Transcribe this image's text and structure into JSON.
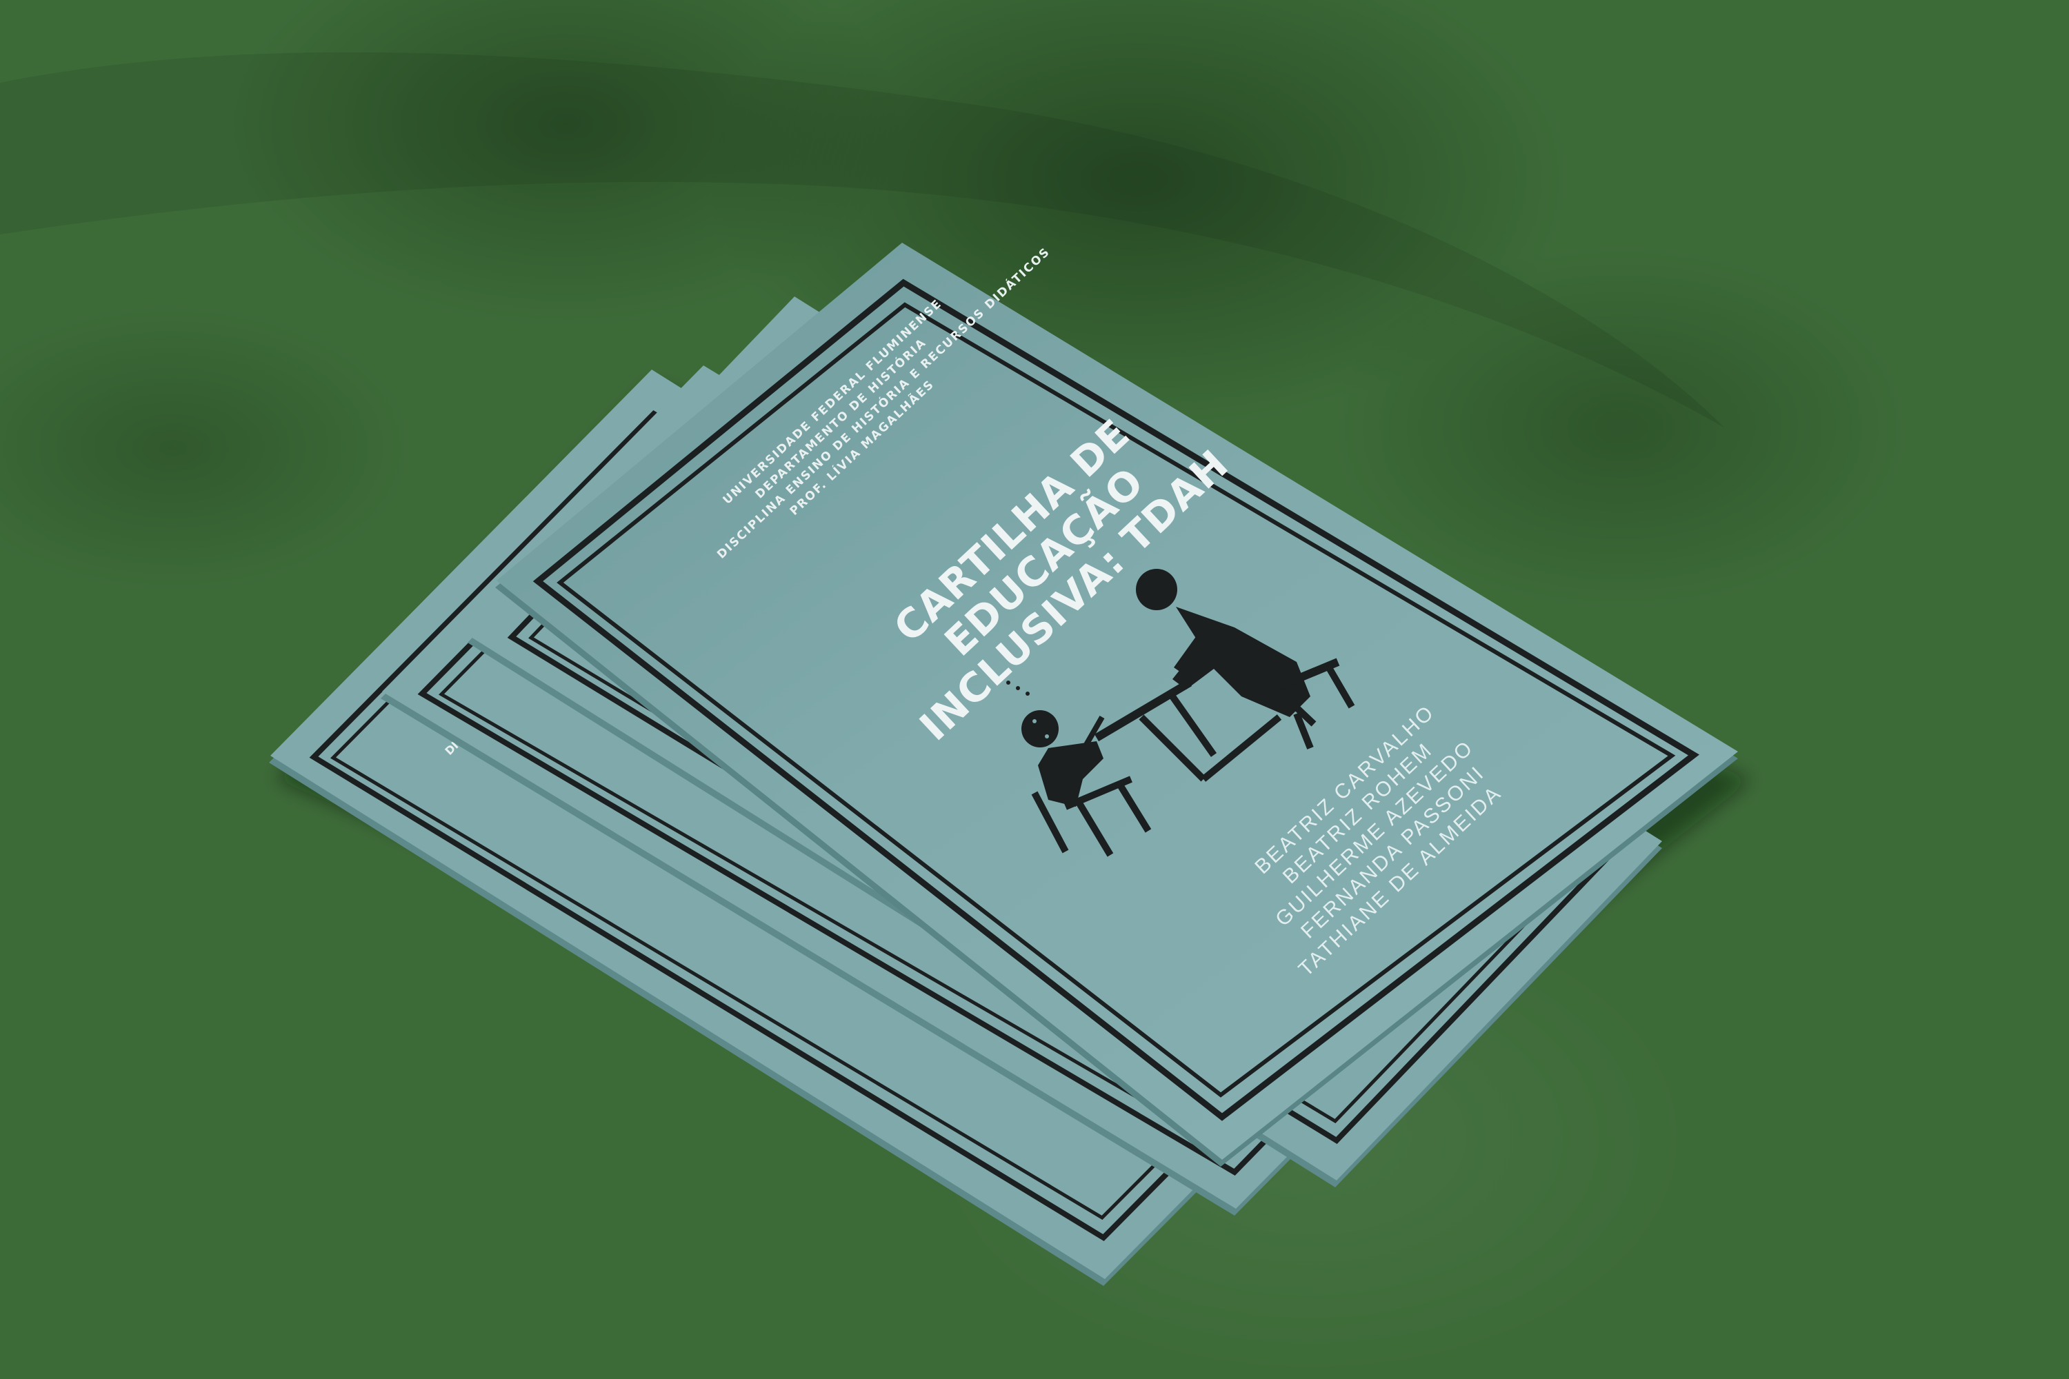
{
  "cover": {
    "institution_lines": [
      "UNIVERSIDADE FEDERAL FLUMINENSE",
      "DEPARTAMENTO DE HISTÓRIA",
      "DISCIPLINA ENSINO DE HISTÓRIA E RECURSOS DIDÁTICOS",
      "PROF. LÍVIA MAGALHÃES"
    ],
    "title_lines": [
      "CARTILHA DE",
      "EDUCAÇÃO",
      "INCLUSIVA: TDAH"
    ],
    "authors": [
      "BEATRIZ CARVALHO",
      "BEATRIZ ROHEM",
      "GUILHERME AZEVEDO",
      "FERNANDA PASSONI",
      "TATHIANE DE ALMEIDA"
    ],
    "peek_text": "DI",
    "illustration_icon": "teacher-helping-student-at-desk-icon"
  },
  "colors": {
    "background": "#3d6b38",
    "cover": "#7fa9ab",
    "border": "#1b1f1f",
    "text": "#eef3f3"
  }
}
